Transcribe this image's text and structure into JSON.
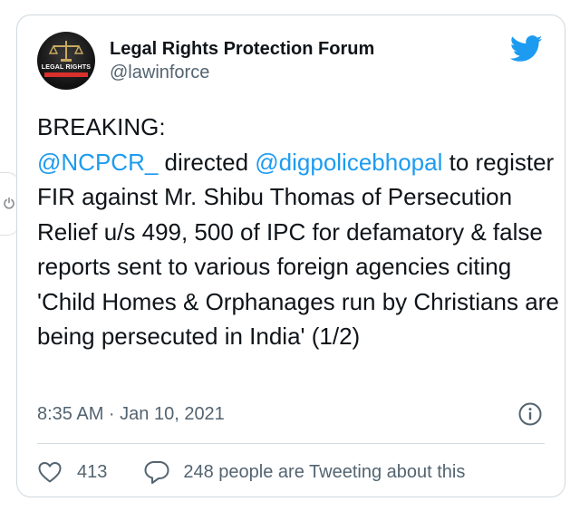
{
  "tweet": {
    "author": {
      "display_name": "Legal Rights Protection Forum",
      "handle": "@lawinforce",
      "avatar_text": "LEGAL RIGHTS"
    },
    "text_parts": {
      "line_breaking": "BREAKING:",
      "mention_1": "@NCPCR_",
      "directed": " directed ",
      "mention_2": "@digpolicebhopal",
      "body": " to register FIR against Mr. Shibu Thomas of Persecution Relief  u/s 499, 500 of IPC for defamatory & false reports sent to various foreign agencies citing 'Child Homes & Orphanages run by Christians are being persecuted in India' (1/2)"
    },
    "timestamp": "8:35 AM · Jan 10, 2021",
    "likes": "413",
    "tweeting_about": "248 people are Tweeting about this"
  },
  "icons": {
    "brand": "twitter-bird-icon",
    "info": "info-icon",
    "like": "heart-icon",
    "reply": "speech-bubble-icon",
    "side": "power-icon"
  },
  "colors": {
    "accent": "#1d9bf0",
    "text": "#0f1419",
    "muted": "#536471",
    "border": "#cfd9de"
  }
}
